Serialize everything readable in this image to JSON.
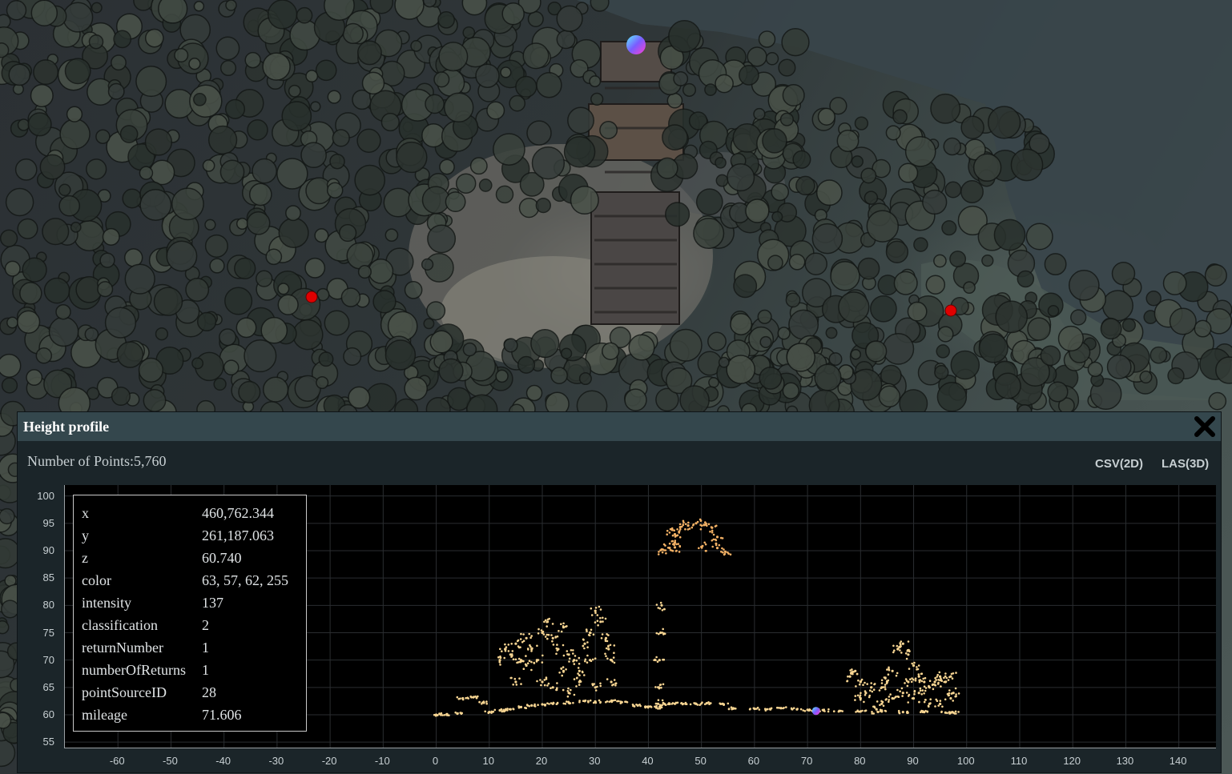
{
  "panel": {
    "title": "Height profile",
    "point_count_label": "Number of Points:",
    "point_count": "5,760",
    "export_buttons": [
      "CSV(2D)",
      "LAS(3D)"
    ]
  },
  "point_info": [
    {
      "key": "x",
      "value": "460,762.344"
    },
    {
      "key": "y",
      "value": "261,187.063"
    },
    {
      "key": "z",
      "value": "60.740"
    },
    {
      "key": "color",
      "value": "63, 57, 62, 255"
    },
    {
      "key": "intensity",
      "value": "137"
    },
    {
      "key": "classification",
      "value": "2"
    },
    {
      "key": "returnNumber",
      "value": "1"
    },
    {
      "key": "numberOfReturns",
      "value": "1"
    },
    {
      "key": "pointSourceID",
      "value": "28"
    },
    {
      "key": "mileage",
      "value": "71.606"
    }
  ],
  "icons": [
    "close-icon",
    "profile-marker-icon",
    "selected-point-icon"
  ],
  "colors": {
    "point": "#f7d592",
    "roof_point": "#f3b165",
    "marker": "#e00000",
    "panel_header": "#34474d",
    "panel_bg": "#1b2529"
  },
  "chart_data": {
    "type": "scatter",
    "title": "",
    "xlabel": "",
    "ylabel": "",
    "xlim": [
      -70,
      147
    ],
    "ylim": [
      54,
      102
    ],
    "x_ticks": [
      -60,
      -50,
      -40,
      -30,
      -20,
      -10,
      0,
      10,
      20,
      30,
      40,
      50,
      60,
      70,
      80,
      90,
      100,
      110,
      120,
      130,
      140
    ],
    "y_ticks": [
      55,
      60,
      65,
      70,
      75,
      80,
      85,
      90,
      95,
      100
    ],
    "grid": true,
    "selected_point": {
      "x": 71.6,
      "y": 60.7
    },
    "series": [
      {
        "points": [
          [
            0,
            60
          ],
          [
            2,
            60.1
          ],
          [
            4,
            60.2
          ],
          [
            5,
            63
          ],
          [
            7,
            63.2
          ],
          [
            9,
            62.2
          ],
          [
            10,
            60.5
          ],
          [
            12,
            60.8
          ],
          [
            14,
            61
          ],
          [
            16,
            61.4
          ],
          [
            18,
            61.7
          ],
          [
            20,
            61.9
          ],
          [
            22,
            62
          ],
          [
            25,
            62.2
          ],
          [
            28,
            62.5
          ],
          [
            30,
            62.4
          ],
          [
            33,
            62.5
          ],
          [
            35,
            62.3
          ],
          [
            38,
            61.7
          ],
          [
            40,
            61.5
          ],
          [
            41.5,
            61.3
          ],
          [
            43,
            62
          ],
          [
            45,
            62
          ],
          [
            47,
            62
          ],
          [
            49,
            62
          ],
          [
            51,
            62.1
          ],
          [
            54,
            62
          ],
          [
            56,
            61.2
          ],
          [
            60,
            61.1
          ],
          [
            63,
            61
          ],
          [
            65,
            61.2
          ],
          [
            68,
            61
          ],
          [
            70,
            60.9
          ],
          [
            73,
            60.8
          ],
          [
            76,
            60.7
          ],
          [
            80,
            60.6
          ],
          [
            84,
            60.6
          ],
          [
            88,
            60.5
          ],
          [
            92,
            60.5
          ],
          [
            96,
            60.4
          ],
          [
            97.5,
            60.4
          ]
        ]
      },
      {
        "points": [
          [
            12,
            70
          ],
          [
            13,
            72
          ],
          [
            14,
            71
          ],
          [
            15,
            73
          ],
          [
            16,
            70
          ],
          [
            15,
            66
          ],
          [
            17,
            69
          ],
          [
            18,
            72
          ],
          [
            20,
            75
          ],
          [
            21,
            77
          ],
          [
            22,
            74
          ],
          [
            23,
            72
          ],
          [
            24,
            76
          ],
          [
            25,
            71
          ],
          [
            26,
            70
          ],
          [
            27,
            68
          ],
          [
            28,
            73
          ],
          [
            29,
            75
          ],
          [
            30,
            79
          ],
          [
            31,
            77
          ],
          [
            32,
            74
          ],
          [
            32.5,
            72
          ],
          [
            33,
            70
          ],
          [
            20,
            66
          ],
          [
            22,
            65
          ],
          [
            25,
            64
          ],
          [
            27,
            66
          ],
          [
            30,
            65
          ],
          [
            33,
            66
          ],
          [
            29,
            70
          ],
          [
            24,
            68
          ],
          [
            19,
            70
          ],
          [
            17,
            74
          ],
          [
            42.5,
            80
          ],
          [
            42.3,
            75
          ],
          [
            42.1,
            70
          ],
          [
            42,
            65
          ],
          [
            41.8,
            62
          ]
        ]
      },
      {
        "points": [
          [
            78,
            67
          ],
          [
            79,
            68
          ],
          [
            80,
            66
          ],
          [
            81,
            64
          ],
          [
            82,
            65
          ],
          [
            80,
            63
          ],
          [
            84,
            65
          ],
          [
            85,
            66
          ],
          [
            86,
            68
          ],
          [
            87,
            72
          ],
          [
            88,
            73
          ],
          [
            89,
            71
          ],
          [
            90,
            69
          ],
          [
            91,
            67
          ],
          [
            92,
            66
          ],
          [
            93,
            65
          ],
          [
            94,
            66
          ],
          [
            95,
            67
          ],
          [
            96,
            66
          ],
          [
            97,
            67
          ],
          [
            97.5,
            64
          ],
          [
            97,
            63
          ],
          [
            95,
            62
          ],
          [
            93,
            62
          ],
          [
            90,
            63
          ],
          [
            88,
            64
          ],
          [
            86,
            63
          ],
          [
            84,
            62
          ],
          [
            83,
            61
          ],
          [
            91,
            64
          ],
          [
            89,
            66
          ]
        ]
      },
      {
        "name": "",
        "points": [
          [
            44.5,
            93.8
          ],
          [
            46,
            94.3
          ],
          [
            47.5,
            94.6
          ],
          [
            49,
            95
          ],
          [
            50.5,
            94.7
          ],
          [
            52,
            94.2
          ],
          [
            42.5,
            90.2
          ],
          [
            44,
            90.5
          ],
          [
            45,
            90.6
          ],
          [
            50,
            90.7
          ],
          [
            53,
            90.5
          ],
          [
            54.5,
            89.8
          ],
          [
            45,
            93
          ],
          [
            45,
            91.5
          ],
          [
            53,
            92.5
          ]
        ]
      }
    ]
  }
}
